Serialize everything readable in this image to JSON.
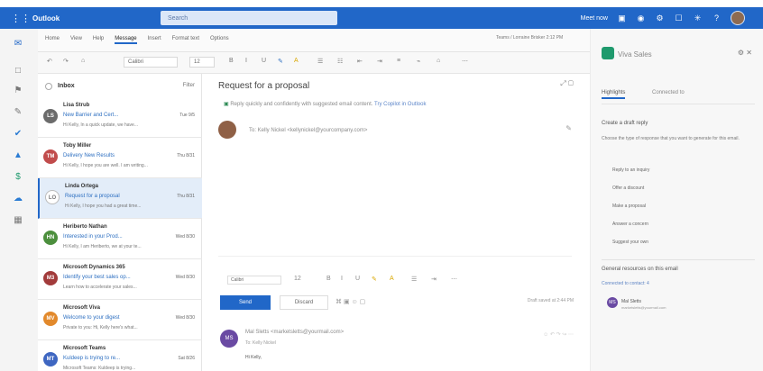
{
  "app": {
    "name": "Outlook",
    "search_placeholder": "Search"
  },
  "topbar": {
    "meet_now": "Meet now",
    "icons": [
      "calendar-icon",
      "teams-icon",
      "gear-icon",
      "bell-icon",
      "help-icon",
      "avatar-icon"
    ]
  },
  "ribbon": {
    "tabs": [
      "Home",
      "View",
      "Help",
      "Message",
      "Insert",
      "Format text",
      "Options"
    ],
    "active_tab": "Message",
    "status": "Teams / Lorraine Brisker 2:12 PM"
  },
  "toolbar": {
    "font": "Calibri",
    "size": "12"
  },
  "inbox": {
    "title": "Inbox",
    "filter": "Filter"
  },
  "mails": [
    {
      "sender": "Lisa Strub",
      "subject": "New Barrier and Cert...",
      "time": "Tue 9/5",
      "preview": "Hi Kelly, In a quick update, we have...",
      "initials": "LS",
      "color": "#6b6b6b"
    },
    {
      "sender": "Toby Miller",
      "subject": "Delivery New Results",
      "time": "Thu 8/31",
      "preview": "Hi Kelly, I hope you are well. I am writing...",
      "initials": "TM",
      "color": "#c14c4c"
    },
    {
      "sender": "Linda Ortega",
      "subject": "Request for a proposal",
      "time": "Thu 8/31",
      "preview": "Hi Kelly, I hope you had a great time...",
      "initials": "LO",
      "color": "#ffffff"
    },
    {
      "sender": "Heriberto Nathan",
      "subject": "Interested in your Prod...",
      "time": "Wed 8/30",
      "preview": "Hi Kelly, I am Heriberto, we at your te...",
      "initials": "HN",
      "color": "#4c8f3d"
    },
    {
      "sender": "Microsoft Dynamics 365",
      "subject": "Identify your best sales op...",
      "time": "Wed 8/30",
      "preview": "Learn how to accelerate your sales...",
      "initials": "M3",
      "color": "#a23b3b"
    },
    {
      "sender": "Microsoft Viva",
      "subject": "Welcome to your digest",
      "time": "Wed 8/30",
      "preview": "Private to you: Hi, Kelly here's what...",
      "initials": "MV",
      "color": "#e2892b"
    },
    {
      "sender": "Microsoft Teams",
      "subject": "Kuldeep is trying to re...",
      "time": "Sat 8/26",
      "preview": "Microsoft Teams: Kuldeep is trying...",
      "initials": "MT",
      "color": "#3e66c1"
    }
  ],
  "reading": {
    "subject": "Request for a proposal",
    "insight": "Reply quickly and confidently with suggested email content.",
    "insight_link": "Try Copilot in Outlook",
    "from": "To: Kelly Nickel <kellynickel@yourcompany.com>",
    "compose_font": "Calibri",
    "send": "Send",
    "discard": "Discard",
    "draft_time": "Draft saved at 2:44 PM",
    "reply_from": "Mal Sletts <marketsletts@yourmail.com>",
    "reply_to": "To: Kelly Nickel",
    "reply_body": "Hi Kelly,"
  },
  "viva": {
    "title": "Viva Sales",
    "tab_active": "Highlights",
    "tab_inactive": "Connected to",
    "card_title": "Create a draft reply",
    "card_desc": "Choose the type of response that you want to generate for this email.",
    "options": [
      "Reply to an inquiry",
      "Offer a discount",
      "Make a proposal",
      "Answer a concern"
    ],
    "suggest": "Suggest your own",
    "resources_title": "General resources on this email",
    "shared": "Connected to contact: 4",
    "resource_name": "Mal Sletts",
    "resource_detail": "marketsletts@yourmail.com"
  }
}
